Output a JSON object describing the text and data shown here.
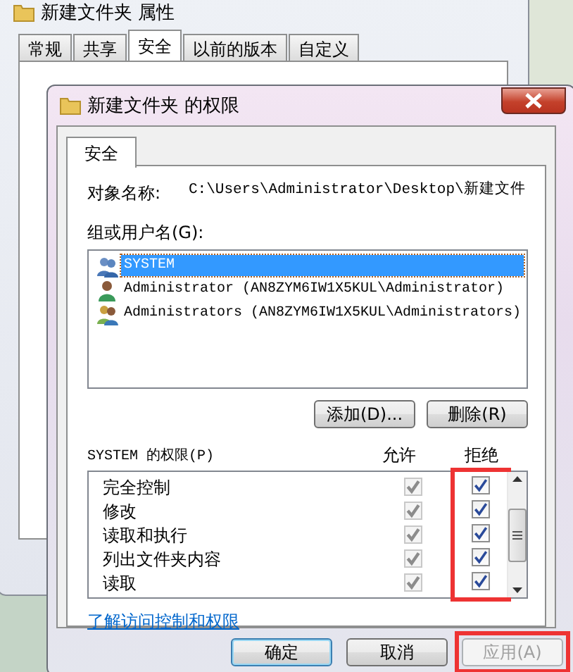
{
  "back_window": {
    "title": "新建文件夹 属性",
    "tabs": [
      {
        "label": "常规",
        "selected": false
      },
      {
        "label": "共享",
        "selected": false
      },
      {
        "label": "安全",
        "selected": true
      },
      {
        "label": "以前的版本",
        "selected": false
      },
      {
        "label": "自定义",
        "selected": false
      }
    ]
  },
  "dialog": {
    "title": "新建文件夹 的权限",
    "tabs": [
      {
        "label": "安全",
        "selected": true
      }
    ],
    "object_label": "对象名称:",
    "object_value": "C:\\Users\\Administrator\\Desktop\\新建文件",
    "group_label": "组或用户名(G):",
    "principals": [
      {
        "name": "SYSTEM",
        "kind": "system",
        "selected": true
      },
      {
        "name": "Administrator (AN8ZYM6IW1X5KUL\\Administrator)",
        "kind": "user",
        "selected": false
      },
      {
        "name": "Administrators (AN8ZYM6IW1X5KUL\\Administrators)",
        "kind": "group",
        "selected": false
      }
    ],
    "add_button": "添加(D)...",
    "remove_button": "删除(R)",
    "permissions_label": "SYSTEM 的权限(P)",
    "allow_header": "允许",
    "deny_header": "拒绝",
    "deny_highlighted": true,
    "permissions": [
      {
        "name": "完全控制",
        "allow": true,
        "allow_disabled": true,
        "deny": true
      },
      {
        "name": "修改",
        "allow": true,
        "allow_disabled": true,
        "deny": true
      },
      {
        "name": "读取和执行",
        "allow": true,
        "allow_disabled": true,
        "deny": true
      },
      {
        "name": "列出文件夹内容",
        "allow": true,
        "allow_disabled": true,
        "deny": true
      },
      {
        "name": "读取",
        "allow": true,
        "allow_disabled": true,
        "deny": true
      }
    ],
    "link": "了解访问控制和权限",
    "buttons": [
      {
        "label": "确定",
        "kind": "default",
        "disabled": false,
        "highlighted": false
      },
      {
        "label": "取消",
        "kind": "normal",
        "disabled": false,
        "highlighted": false
      },
      {
        "label": "应用(A)",
        "kind": "normal",
        "disabled": true,
        "highlighted": true
      }
    ]
  }
}
